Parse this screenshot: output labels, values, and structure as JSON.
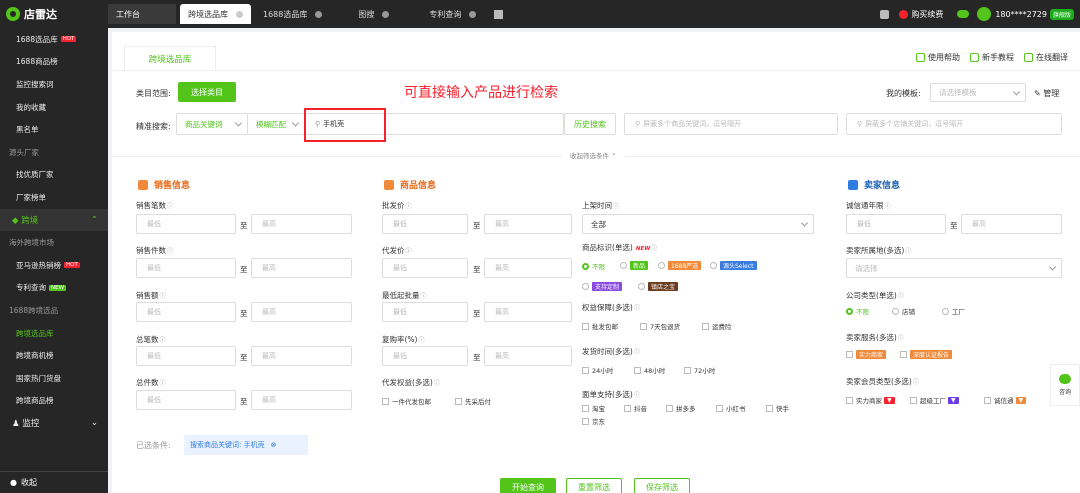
{
  "app": {
    "name": "店雷达"
  },
  "tabs": [
    {
      "label": "工作台"
    },
    {
      "label": "跨境选品库"
    },
    {
      "label": "1688选品库"
    },
    {
      "label": "图搜"
    },
    {
      "label": "专利查询"
    }
  ],
  "topbar": {
    "renew": "购买续费",
    "phone": "180****2729",
    "flag": "旗舰版"
  },
  "sidebar": {
    "items": [
      {
        "label": "1688选品库",
        "badge": "HOT"
      },
      {
        "label": "1688商品榜"
      },
      {
        "label": "监控搜索词"
      },
      {
        "label": "我的收藏"
      },
      {
        "label": "黑名单"
      },
      {
        "label": "源头厂家",
        "group": true
      },
      {
        "label": "找优质厂家"
      },
      {
        "label": "厂家榜单"
      },
      {
        "label": "跨境",
        "cat": true
      },
      {
        "label": "海外跨境市场",
        "group": true
      },
      {
        "label": "亚马逊热销榜",
        "badge": "HOT"
      },
      {
        "label": "专利查询",
        "badge": "NEW"
      },
      {
        "label": "1688跨境选品",
        "group": true
      },
      {
        "label": "跨境选品库",
        "selected": true
      },
      {
        "label": "跨境商机榜"
      },
      {
        "label": "国家热门货盘"
      },
      {
        "label": "跨境商品榜"
      },
      {
        "label": "监控",
        "cat": true
      }
    ],
    "collapse": "收起"
  },
  "main": {
    "tab": "跨境选品库",
    "help": [
      "使用帮助",
      "新手教程",
      "在线翻译"
    ],
    "category_label": "类目范围:",
    "category_button": "选择类目",
    "annotation": "可直接输入产品进行检索",
    "template_label": "我的模板:",
    "template_placeholder": "请选择模板",
    "manage": "管理",
    "search_label": "精准搜索:",
    "keyword_select": "商品关键词",
    "match_select": "模糊匹配",
    "search_value": "手机壳",
    "history": "历史搜索",
    "multi_product_placeholder": "屏蔽多个商品关键词，逗号隔开",
    "multi_shop_placeholder": "屏蔽多个店铺关键词，逗号隔开",
    "collapse_text": "收起筛选条件"
  },
  "sections": {
    "sales": "销售信息",
    "product": "商品信息",
    "seller": "卖家信息"
  },
  "fields": {
    "min": "最低",
    "max": "最高",
    "to": "至",
    "sales_count": "销售笔数",
    "sales_pieces": "销售件数",
    "sales_amount": "销售额",
    "total_count": "总笔数",
    "total_pieces": "总件数",
    "wholesale_price": "批发价",
    "dropship_price": "代发价",
    "min_batch": "最低起批量",
    "repurchase": "复购率(%)",
    "dropship_rights": "代发权益(多选)",
    "rights_opts": [
      "一件代发包邮",
      "先采后付"
    ],
    "listed_time": "上架时间",
    "listed_value": "全部",
    "product_tag": "商品标识(单选)",
    "tag_new": "NEW",
    "tag_opts": [
      "不限",
      "新品",
      "1688严选",
      "源头Select",
      "支持定制",
      "镇店之宝"
    ],
    "guarantee": "权益保障(多选)",
    "guarantee_opts": [
      "批发包邮",
      "7天包退货",
      "运费险"
    ],
    "ship_time": "发货时间(多选)",
    "ship_opts": [
      "24小时",
      "48小时",
      "72小时"
    ],
    "waybill": "面单支持(多选)",
    "waybill_opts": [
      "淘宝",
      "抖音",
      "拼多多",
      "小红书",
      "快手",
      "京东"
    ],
    "cxt_years": "诚信通年限",
    "seller_region": "卖家所属地(多选)",
    "region_placeholder": "请选择",
    "company_type": "公司类型(单选)",
    "company_opts": [
      "不限",
      "店铺",
      "工厂"
    ],
    "seller_service": "卖家服务(多选)",
    "service_opts": [
      "实力商家",
      "深度认证报告"
    ],
    "member_type": "卖家会员类型(多选)",
    "member_opts": [
      "实力商家",
      "超级工厂",
      "诚信通"
    ]
  },
  "selected": {
    "label": "已选条件:",
    "chip": "搜索商品关键词: 手机壳"
  },
  "buttons": {
    "start": "开始查询",
    "reset": "重置筛选",
    "save": "保存筛选"
  },
  "float": {
    "label": "咨询"
  },
  "colors": {
    "accent": "#52c41a",
    "sidebar": "#262626",
    "annotation": "#f5222d"
  }
}
